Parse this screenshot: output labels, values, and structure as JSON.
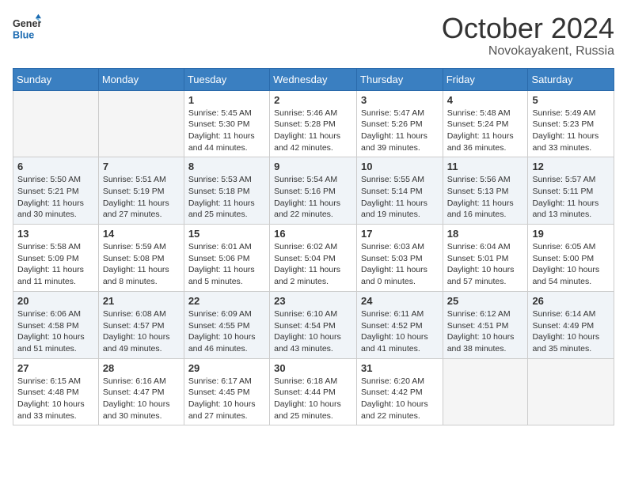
{
  "header": {
    "logo_line1": "General",
    "logo_line2": "Blue",
    "month": "October 2024",
    "location": "Novokayakent, Russia"
  },
  "weekdays": [
    "Sunday",
    "Monday",
    "Tuesday",
    "Wednesday",
    "Thursday",
    "Friday",
    "Saturday"
  ],
  "weeks": [
    [
      {
        "day": "",
        "info": ""
      },
      {
        "day": "",
        "info": ""
      },
      {
        "day": "1",
        "info": "Sunrise: 5:45 AM\nSunset: 5:30 PM\nDaylight: 11 hours and 44 minutes."
      },
      {
        "day": "2",
        "info": "Sunrise: 5:46 AM\nSunset: 5:28 PM\nDaylight: 11 hours and 42 minutes."
      },
      {
        "day": "3",
        "info": "Sunrise: 5:47 AM\nSunset: 5:26 PM\nDaylight: 11 hours and 39 minutes."
      },
      {
        "day": "4",
        "info": "Sunrise: 5:48 AM\nSunset: 5:24 PM\nDaylight: 11 hours and 36 minutes."
      },
      {
        "day": "5",
        "info": "Sunrise: 5:49 AM\nSunset: 5:23 PM\nDaylight: 11 hours and 33 minutes."
      }
    ],
    [
      {
        "day": "6",
        "info": "Sunrise: 5:50 AM\nSunset: 5:21 PM\nDaylight: 11 hours and 30 minutes."
      },
      {
        "day": "7",
        "info": "Sunrise: 5:51 AM\nSunset: 5:19 PM\nDaylight: 11 hours and 27 minutes."
      },
      {
        "day": "8",
        "info": "Sunrise: 5:53 AM\nSunset: 5:18 PM\nDaylight: 11 hours and 25 minutes."
      },
      {
        "day": "9",
        "info": "Sunrise: 5:54 AM\nSunset: 5:16 PM\nDaylight: 11 hours and 22 minutes."
      },
      {
        "day": "10",
        "info": "Sunrise: 5:55 AM\nSunset: 5:14 PM\nDaylight: 11 hours and 19 minutes."
      },
      {
        "day": "11",
        "info": "Sunrise: 5:56 AM\nSunset: 5:13 PM\nDaylight: 11 hours and 16 minutes."
      },
      {
        "day": "12",
        "info": "Sunrise: 5:57 AM\nSunset: 5:11 PM\nDaylight: 11 hours and 13 minutes."
      }
    ],
    [
      {
        "day": "13",
        "info": "Sunrise: 5:58 AM\nSunset: 5:09 PM\nDaylight: 11 hours and 11 minutes."
      },
      {
        "day": "14",
        "info": "Sunrise: 5:59 AM\nSunset: 5:08 PM\nDaylight: 11 hours and 8 minutes."
      },
      {
        "day": "15",
        "info": "Sunrise: 6:01 AM\nSunset: 5:06 PM\nDaylight: 11 hours and 5 minutes."
      },
      {
        "day": "16",
        "info": "Sunrise: 6:02 AM\nSunset: 5:04 PM\nDaylight: 11 hours and 2 minutes."
      },
      {
        "day": "17",
        "info": "Sunrise: 6:03 AM\nSunset: 5:03 PM\nDaylight: 11 hours and 0 minutes."
      },
      {
        "day": "18",
        "info": "Sunrise: 6:04 AM\nSunset: 5:01 PM\nDaylight: 10 hours and 57 minutes."
      },
      {
        "day": "19",
        "info": "Sunrise: 6:05 AM\nSunset: 5:00 PM\nDaylight: 10 hours and 54 minutes."
      }
    ],
    [
      {
        "day": "20",
        "info": "Sunrise: 6:06 AM\nSunset: 4:58 PM\nDaylight: 10 hours and 51 minutes."
      },
      {
        "day": "21",
        "info": "Sunrise: 6:08 AM\nSunset: 4:57 PM\nDaylight: 10 hours and 49 minutes."
      },
      {
        "day": "22",
        "info": "Sunrise: 6:09 AM\nSunset: 4:55 PM\nDaylight: 10 hours and 46 minutes."
      },
      {
        "day": "23",
        "info": "Sunrise: 6:10 AM\nSunset: 4:54 PM\nDaylight: 10 hours and 43 minutes."
      },
      {
        "day": "24",
        "info": "Sunrise: 6:11 AM\nSunset: 4:52 PM\nDaylight: 10 hours and 41 minutes."
      },
      {
        "day": "25",
        "info": "Sunrise: 6:12 AM\nSunset: 4:51 PM\nDaylight: 10 hours and 38 minutes."
      },
      {
        "day": "26",
        "info": "Sunrise: 6:14 AM\nSunset: 4:49 PM\nDaylight: 10 hours and 35 minutes."
      }
    ],
    [
      {
        "day": "27",
        "info": "Sunrise: 6:15 AM\nSunset: 4:48 PM\nDaylight: 10 hours and 33 minutes."
      },
      {
        "day": "28",
        "info": "Sunrise: 6:16 AM\nSunset: 4:47 PM\nDaylight: 10 hours and 30 minutes."
      },
      {
        "day": "29",
        "info": "Sunrise: 6:17 AM\nSunset: 4:45 PM\nDaylight: 10 hours and 27 minutes."
      },
      {
        "day": "30",
        "info": "Sunrise: 6:18 AM\nSunset: 4:44 PM\nDaylight: 10 hours and 25 minutes."
      },
      {
        "day": "31",
        "info": "Sunrise: 6:20 AM\nSunset: 4:42 PM\nDaylight: 10 hours and 22 minutes."
      },
      {
        "day": "",
        "info": ""
      },
      {
        "day": "",
        "info": ""
      }
    ]
  ]
}
